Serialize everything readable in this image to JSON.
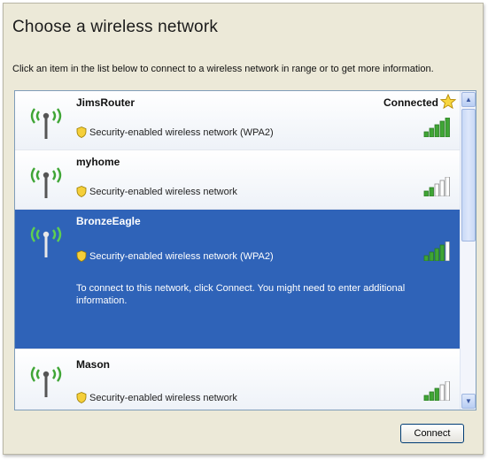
{
  "dialog": {
    "title": "Choose a wireless network",
    "instructions": "Click an item in the list below to connect to a wireless network in range or to get more information."
  },
  "networks": [
    {
      "name": "JimsRouter",
      "status": "Connected",
      "security": "Security-enabled wireless network (WPA2)",
      "signal_bars": 5,
      "selected": false
    },
    {
      "name": "myhome",
      "status": "",
      "security": "Security-enabled wireless network",
      "signal_bars": 2,
      "selected": false
    },
    {
      "name": "BronzeEagle",
      "status": "",
      "security": "Security-enabled wireless network (WPA2)",
      "signal_bars": 4,
      "selected": true,
      "message": "To connect to this network, click Connect. You might need to enter additional information."
    },
    {
      "name": "Mason",
      "status": "",
      "security": "Security-enabled wireless network",
      "signal_bars": 3,
      "selected": false
    }
  ],
  "icons": {
    "antenna": "wireless-antenna-icon",
    "shield": "security-shield-icon",
    "star": "preferred-star-icon",
    "signal": "signal-strength-icon",
    "scroll_up": "scroll-up-arrow-icon",
    "scroll_down": "scroll-down-arrow-icon"
  },
  "colors": {
    "selected_bg": "#2f63b8",
    "signal_on": "#3fa535",
    "signal_off": "#ffffff",
    "antenna_waves": "#3fa535"
  },
  "buttons": {
    "connect": "Connect"
  }
}
